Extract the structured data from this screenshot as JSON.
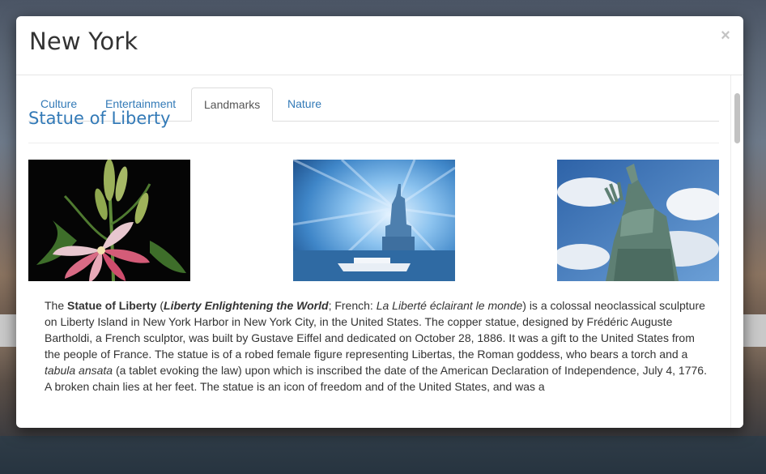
{
  "modal": {
    "title": "New York",
    "close": "×"
  },
  "tabs": [
    {
      "label": "Culture",
      "active": false
    },
    {
      "label": "Entertainment",
      "active": false
    },
    {
      "label": "Landmarks",
      "active": true
    },
    {
      "label": "Nature",
      "active": false
    }
  ],
  "article": {
    "title": "Statue of Liberty",
    "images": [
      {
        "icon": "lily-flower-photo"
      },
      {
        "icon": "statue-light-rays-photo"
      },
      {
        "icon": "statue-sky-photo"
      }
    ],
    "description": {
      "p1": "The ",
      "b1": "Statue of Liberty",
      "p2": " (",
      "bi1": "Liberty Enlightening the World",
      "p3": "; French: ",
      "i1": "La Liberté éclairant le monde",
      "p4": ") is a colossal neoclassical sculpture on Liberty Island in New York Harbor in New York City, in the United States. The copper statue, designed by Frédéric Auguste Bartholdi, a French sculptor, was built by Gustave Eiffel and dedicated on October 28, 1886. It was a gift to the United States from the people of France. The statue is of a robed female figure representing Libertas, the Roman goddess, who bears a torch and a ",
      "i2": "tabula ansata",
      "p5": " (a tablet evoking the law) upon which is inscribed the date of the American Declaration of Independence, July 4, 1776. A broken chain lies at her feet. The statue is an icon of freedom and of the United States, and was a"
    }
  },
  "colors": {
    "accent": "#337ab7",
    "text": "#333333"
  }
}
